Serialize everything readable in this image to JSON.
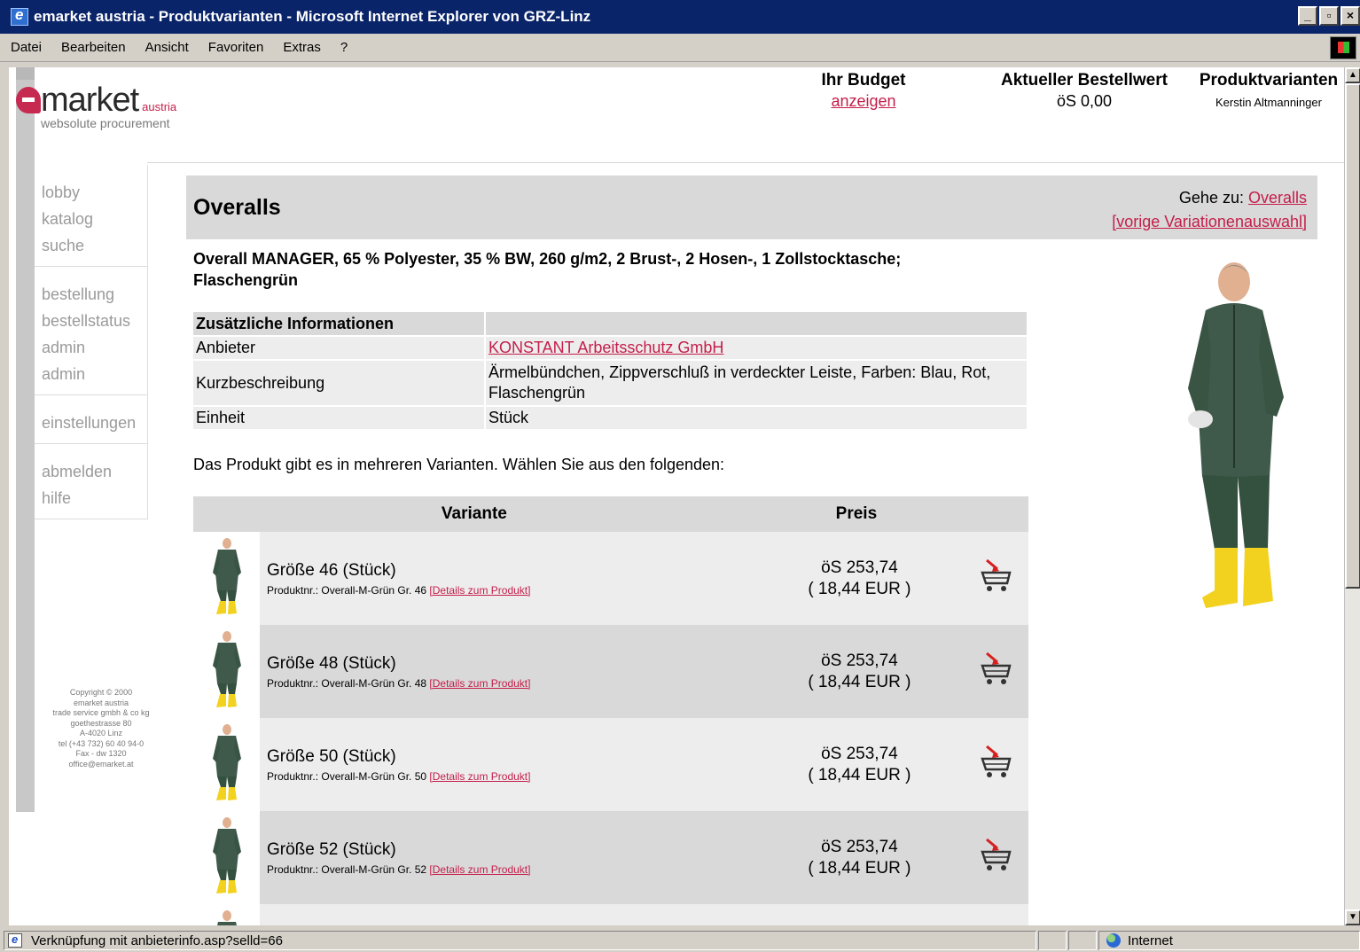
{
  "window": {
    "title": "emarket austria - Produktvarianten - Microsoft Internet Explorer von GRZ-Linz",
    "controls": [
      "_",
      "▫",
      "×"
    ]
  },
  "menu": [
    "Datei",
    "Bearbeiten",
    "Ansicht",
    "Favoriten",
    "Extras",
    "?"
  ],
  "logo": {
    "word": "market",
    "country": "austria",
    "tagline": "websolute procurement"
  },
  "header": {
    "budget_title": "Ihr Budget",
    "budget_link": "anzeigen",
    "order_value_title": "Aktueller Bestellwert",
    "order_value": "öS 0,00",
    "page_title": "Produktvarianten",
    "user": "Kerstin Altmanninger"
  },
  "nav": [
    [
      "lobby",
      "katalog",
      "suche"
    ],
    [
      "bestellung",
      "bestellstatus",
      "admin",
      "admin"
    ],
    [
      "einstellungen"
    ],
    [
      "abmelden",
      "hilfe"
    ]
  ],
  "copyright": [
    "Copyright © 2000",
    "emarket austria",
    "trade service gmbh & co kg",
    "goethestrasse 80",
    "A-4020 Linz",
    "tel (+43 732) 60 40 94-0",
    "Fax - dw 1320",
    "office@emarket.at"
  ],
  "product": {
    "title": "Overalls",
    "goto_label": "Gehe zu:",
    "goto_link": "Overalls",
    "prev_link": "[vorige Variationenauswahl]",
    "description": "Overall MANAGER, 65 % Polyester, 35 % BW, 260 g/m2, 2 Brust-, 2 Hosen-, 1 Zollstocktasche; Flaschengrün"
  },
  "info": {
    "header": "Zusätzliche Informationen",
    "rows": [
      {
        "label": "Anbieter",
        "value": "KONSTANT Arbeitsschutz GmbH"
      },
      {
        "label": "Kurzbeschreibung",
        "value": "Ärmelbündchen, Zippverschluß in verdeckter Leiste, Farben: Blau, Rot, Flaschengrün"
      },
      {
        "label": "Einheit",
        "value": "Stück"
      }
    ]
  },
  "intro": "Das Produkt gibt es in mehreren Varianten. Wählen Sie aus den folgenden:",
  "variants": {
    "col_variant": "Variante",
    "col_price": "Preis",
    "prodnr_label": "Produktnr.:",
    "details_link": "[Details zum Produkt]",
    "items": [
      {
        "name": "Größe 46 (Stück)",
        "prodnr": "Overall-M-Grün Gr. 46",
        "price": "öS 253,74",
        "price_eur": "( 18,44 EUR )"
      },
      {
        "name": "Größe 48 (Stück)",
        "prodnr": "Overall-M-Grün Gr. 48",
        "price": "öS 253,74",
        "price_eur": "( 18,44 EUR )"
      },
      {
        "name": "Größe 50 (Stück)",
        "prodnr": "Overall-M-Grün Gr. 50",
        "price": "öS 253,74",
        "price_eur": "( 18,44 EUR )"
      },
      {
        "name": "Größe 52 (Stück)",
        "prodnr": "Overall-M-Grün Gr. 52",
        "price": "öS 253,74",
        "price_eur": "( 18,44 EUR )"
      }
    ]
  },
  "status": {
    "text": "Verknüpfung mit anbieterinfo.asp?selld=66",
    "zone": "Internet"
  },
  "colors": {
    "link": "#c41e4a",
    "title_bar": "#0a246a",
    "panel": "#d9d9d9",
    "row_light": "#ededed"
  }
}
